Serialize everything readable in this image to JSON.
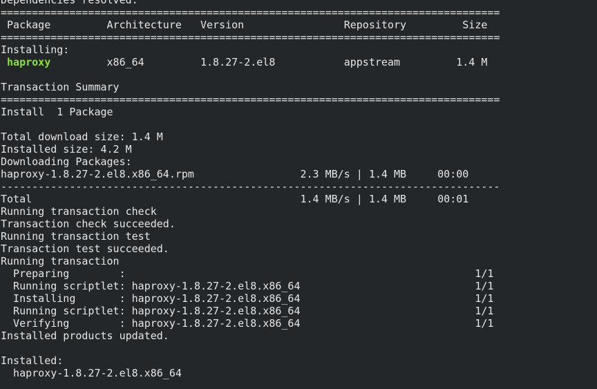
{
  "terminal": {
    "lines": [
      "Dependencies resolved.",
      "================================================================================",
      " Package         Architecture   Version                Repository         Size",
      "================================================================================",
      "Installing:",
      null,
      "",
      "Transaction Summary",
      "================================================================================",
      "Install  1 Package",
      "",
      "Total download size: 1.4 M",
      "Installed size: 4.2 M",
      "Downloading Packages:",
      "haproxy-1.8.27-2.el8.x86_64.rpm                 2.3 MB/s | 1.4 MB     00:00",
      "--------------------------------------------------------------------------------",
      "Total                                           1.4 MB/s | 1.4 MB     00:01",
      "Running transaction check",
      "Transaction check succeeded.",
      "Running transaction test",
      "Transaction test succeeded.",
      "Running transaction",
      "  Preparing        :                                                        1/1",
      "  Running scriptlet: haproxy-1.8.27-2.el8.x86_64                            1/1",
      "  Installing       : haproxy-1.8.27-2.el8.x86_64                            1/1",
      "  Running scriptlet: haproxy-1.8.27-2.el8.x86_64                            1/1",
      "  Verifying        : haproxy-1.8.27-2.el8.x86_64                            1/1",
      "Installed products updated.",
      "",
      "Installed:",
      "  haproxy-1.8.27-2.el8.x86_64"
    ],
    "package_row": {
      "lead": " ",
      "name": "haproxy",
      "rest": "         x86_64         1.8.27-2.el8           appstream         1.4 M"
    },
    "colors": {
      "background": "#24272a",
      "text": "#e6e6e6",
      "package_highlight": "#8ae234"
    }
  }
}
